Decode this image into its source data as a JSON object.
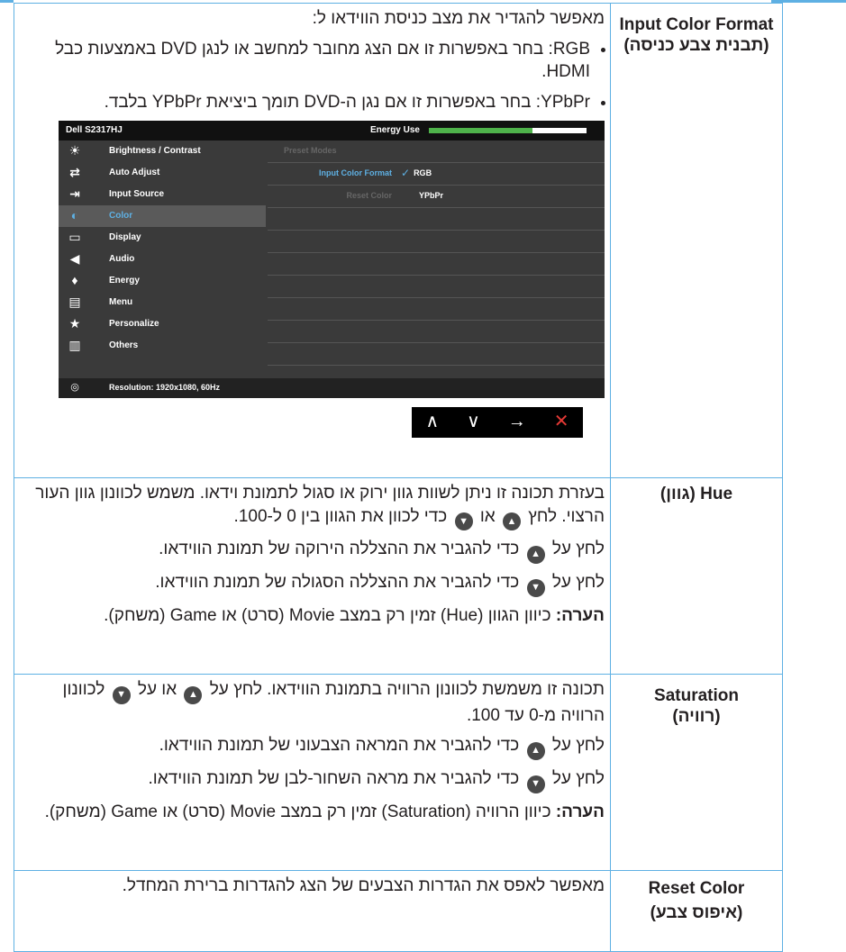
{
  "input_color_format": {
    "name": "Input Color Format",
    "name_he": "(תבנית צבע כניסה)",
    "intro": "מאפשר להגדיר את מצב כניסת הווידאו ל:",
    "bullet1": "RGB: בחר באפשרות זו אם הצג מחובר למחשב או לנגן DVD באמצעות כבל HDMI.",
    "bullet2": "YPbPr: בחר באפשרות זו אם נגן ה-DVD תומך ביציאת YPbPr בלבד."
  },
  "osd": {
    "model": "Dell S2317HJ",
    "energy_label": "Energy Use",
    "menu": [
      {
        "icon": "brightness-icon",
        "glyph": "☀",
        "label": "Brightness / Contrast"
      },
      {
        "icon": "auto-adjust-icon",
        "glyph": "⇄",
        "label": "Auto Adjust"
      },
      {
        "icon": "input-source-icon",
        "glyph": "⇥",
        "label": "Input Source"
      },
      {
        "icon": "color-icon",
        "glyph": "◐",
        "label": "Color"
      },
      {
        "icon": "display-icon",
        "glyph": "▭",
        "label": "Display"
      },
      {
        "icon": "audio-icon",
        "glyph": "◀",
        "label": "Audio"
      },
      {
        "icon": "energy-icon",
        "glyph": "♦",
        "label": "Energy"
      },
      {
        "icon": "menu-icon",
        "glyph": "▤",
        "label": "Menu"
      },
      {
        "icon": "personalize-icon",
        "glyph": "★",
        "label": "Personalize"
      },
      {
        "icon": "others-icon",
        "glyph": "▥",
        "label": "Others"
      }
    ],
    "submenu": {
      "preset_modes": "Preset Modes",
      "input_color_format": "Input Color Format",
      "check": "✓",
      "rgb": "RGB",
      "reset_color": "Reset Color",
      "ypbpr": "YPbPr"
    },
    "resolution": "Resolution: 1920x1080, 60Hz",
    "nav": {
      "up": "∧",
      "down": "∨",
      "enter": "→",
      "exit": "✕"
    }
  },
  "hue": {
    "name": "Hue (גוון)",
    "p1": "בעזרת תכונה זו ניתן לשוות גוון ירוק או סגול לתמונת וידאו. משמש לכוונון גוון העור הרצוי. לחץ",
    "p1_or": "או",
    "p1_end": "כדי לכוון את הגוון בין 0 ל-100.",
    "p2_a": "לחץ על",
    "p2_b": "כדי להגביר את ההצללה הירוקה של תמונת הווידאו.",
    "p3_a": "לחץ על",
    "p3_b": "כדי להגביר את ההצללה הסגולה של תמונת הווידאו.",
    "note_label": "הערה:",
    "note": "כיוון הגוון (Hue) זמין רק במצב Movie (סרט) או Game (משחק)."
  },
  "saturation": {
    "name": "Saturation",
    "name_he": "(רוויה)",
    "p1_a": "תכונה זו משמשת לכוונון הרוויה בתמונת הווידאו. לחץ על",
    "p1_or": "או על",
    "p1_end": "לכוונון הרוויה מ-0 עד 100.",
    "p2_a": "לחץ על",
    "p2_b": "כדי להגביר את המראה הצבעוני של תמונת הווידאו.",
    "p3_a": "לחץ על",
    "p3_b": "כדי להגביר את מראה השחור-לבן של תמונת הווידאו.",
    "note_label": "הערה:",
    "note": "כיוון הרוויה (Saturation) זמין רק במצב Movie (סרט) או Game (משחק)."
  },
  "reset_color": {
    "name": "Reset Color",
    "name_he": "(איפוס צבע)",
    "desc": "מאפשר לאפס את הגדרות הצבעים של הצג להגדרות ברירת המחדל."
  },
  "icons": {
    "up": "▲",
    "down": "▼"
  }
}
